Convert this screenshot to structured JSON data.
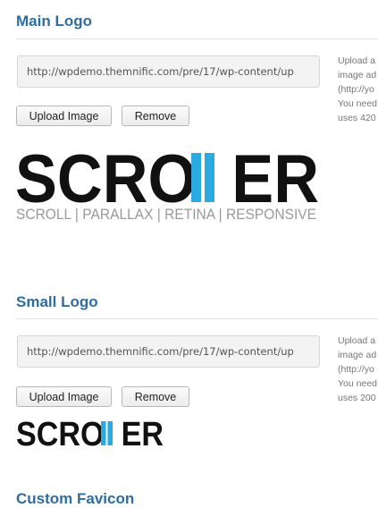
{
  "main_logo": {
    "title": "Main Logo",
    "url_value": "http://wpdemo.themnific.com/pre/17/wp-content/up",
    "upload_label": "Upload Image",
    "remove_label": "Remove",
    "help_lines": [
      "Upload a",
      "image ad",
      "(http://yo",
      "You need",
      "uses 420"
    ],
    "logo_text": "SCRO  ER",
    "logo_tagline": "SCROLL | PARALLAX | RETINA | RESPONSIVE",
    "accent_color": "#29abe2"
  },
  "small_logo": {
    "title": "Small Logo",
    "url_value": "http://wpdemo.themnific.com/pre/17/wp-content/up",
    "upload_label": "Upload Image",
    "remove_label": "Remove",
    "help_lines": [
      "Upload a",
      "image ad",
      "(http://yo",
      "You need",
      "uses 200"
    ],
    "logo_text": "SCRO  ER"
  },
  "custom_favicon": {
    "title": "Custom Favicon"
  }
}
